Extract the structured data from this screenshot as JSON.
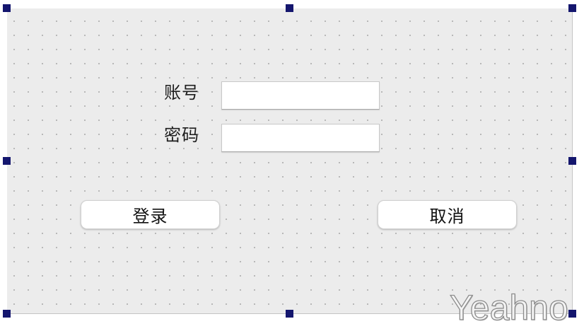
{
  "form": {
    "account_label": "账号",
    "account_value": "",
    "password_label": "密码",
    "password_value": "",
    "login_button": "登录",
    "cancel_button": "取消"
  },
  "watermark": {
    "text": "Yeahno"
  },
  "colors": {
    "canvas_background": "#ececec",
    "grid_dot": "#a9a9a9",
    "selection_handle": "#14166e",
    "button_background": "#ffffff",
    "field_background": "#ffffff"
  },
  "icons": {
    "selection_handles": "square-handle"
  }
}
